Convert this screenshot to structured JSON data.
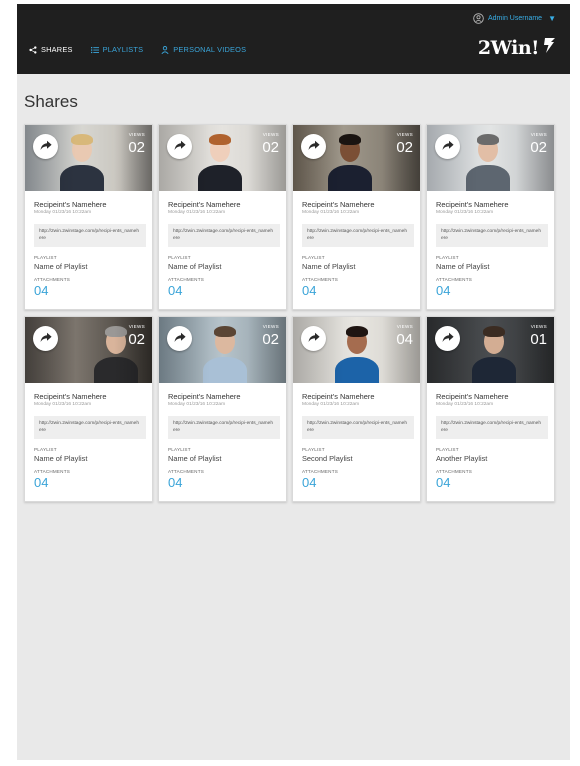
{
  "header": {
    "user": {
      "name": "Admin Username",
      "icon": "user-circle-icon",
      "caret": "▼"
    },
    "brand": {
      "text": "2Win!",
      "icon": "lightning-bolt-icon"
    },
    "nav": [
      {
        "label": "SHARES",
        "icon": "share-icon",
        "active": true
      },
      {
        "label": "PLAYLISTS",
        "icon": "list-icon",
        "active": false
      },
      {
        "label": "PERSONAL VIDEOS",
        "icon": "person-icon",
        "active": false
      }
    ]
  },
  "page": {
    "title": "Shares"
  },
  "labels": {
    "views": "VIEWS",
    "playlist": "PLAYLIST",
    "attachments": "ATTACHMENTS"
  },
  "colors": {
    "accent": "#3aa4d8",
    "topbar": "#1f1f1f",
    "background": "#e9e9e9"
  },
  "cards": [
    {
      "recipient": "Recipeint's Namehere",
      "date": "Monday 01/23/16 10:22am",
      "url": "http://2win.2winstage.com/p/recipi-ents_namehere",
      "playlist": "Name of Playlist",
      "attachments": "04",
      "views": "02",
      "photo": "woman-blonde-office"
    },
    {
      "recipient": "Recipeint's Namehere",
      "date": "Monday 01/23/16 10:22am",
      "url": "http://2win.2winstage.com/p/recipi-ents_namehere",
      "playlist": "Name of Playlist",
      "attachments": "04",
      "views": "02",
      "photo": "woman-redhead-office"
    },
    {
      "recipient": "Recipeint's Namehere",
      "date": "Monday 01/23/16 10:22am",
      "url": "http://2win.2winstage.com/p/recipi-ents_namehere",
      "playlist": "Name of Playlist",
      "attachments": "04",
      "views": "02",
      "photo": "man-dark-suit-office"
    },
    {
      "recipient": "Recipeint's Namehere",
      "date": "Monday 01/23/16 10:22am",
      "url": "http://2win.2winstage.com/p/recipi-ents_namehere",
      "playlist": "Name of Playlist",
      "attachments": "04",
      "views": "02",
      "photo": "man-glasses-office"
    },
    {
      "recipient": "Recipeint's Namehere",
      "date": "Monday 01/23/16 10:22am",
      "url": "http://2win.2winstage.com/p/recipi-ents_namehere",
      "playlist": "Name of Playlist",
      "attachments": "04",
      "views": "02",
      "photo": "man-gray-suit"
    },
    {
      "recipient": "Recipeint's Namehere",
      "date": "Monday 01/23/16 10:22am",
      "url": "http://2win.2winstage.com/p/recipi-ents_namehere",
      "playlist": "Name of Playlist",
      "attachments": "04",
      "views": "02",
      "photo": "man-light-shirt"
    },
    {
      "recipient": "Recipeint's Namehere",
      "date": "Monday 01/23/16 10:22am",
      "url": "http://2win.2winstage.com/p/recipi-ents_namehere",
      "playlist": "Second Playlist",
      "attachments": "04",
      "views": "04",
      "photo": "woman-blue-dress"
    },
    {
      "recipient": "Recipeint's Namehere",
      "date": "Monday 01/23/16 10:22am",
      "url": "http://2win.2winstage.com/p/recipi-ents_namehere",
      "playlist": "Another Playlist",
      "attachments": "04",
      "views": "01",
      "photo": "man-navy-suit"
    }
  ]
}
